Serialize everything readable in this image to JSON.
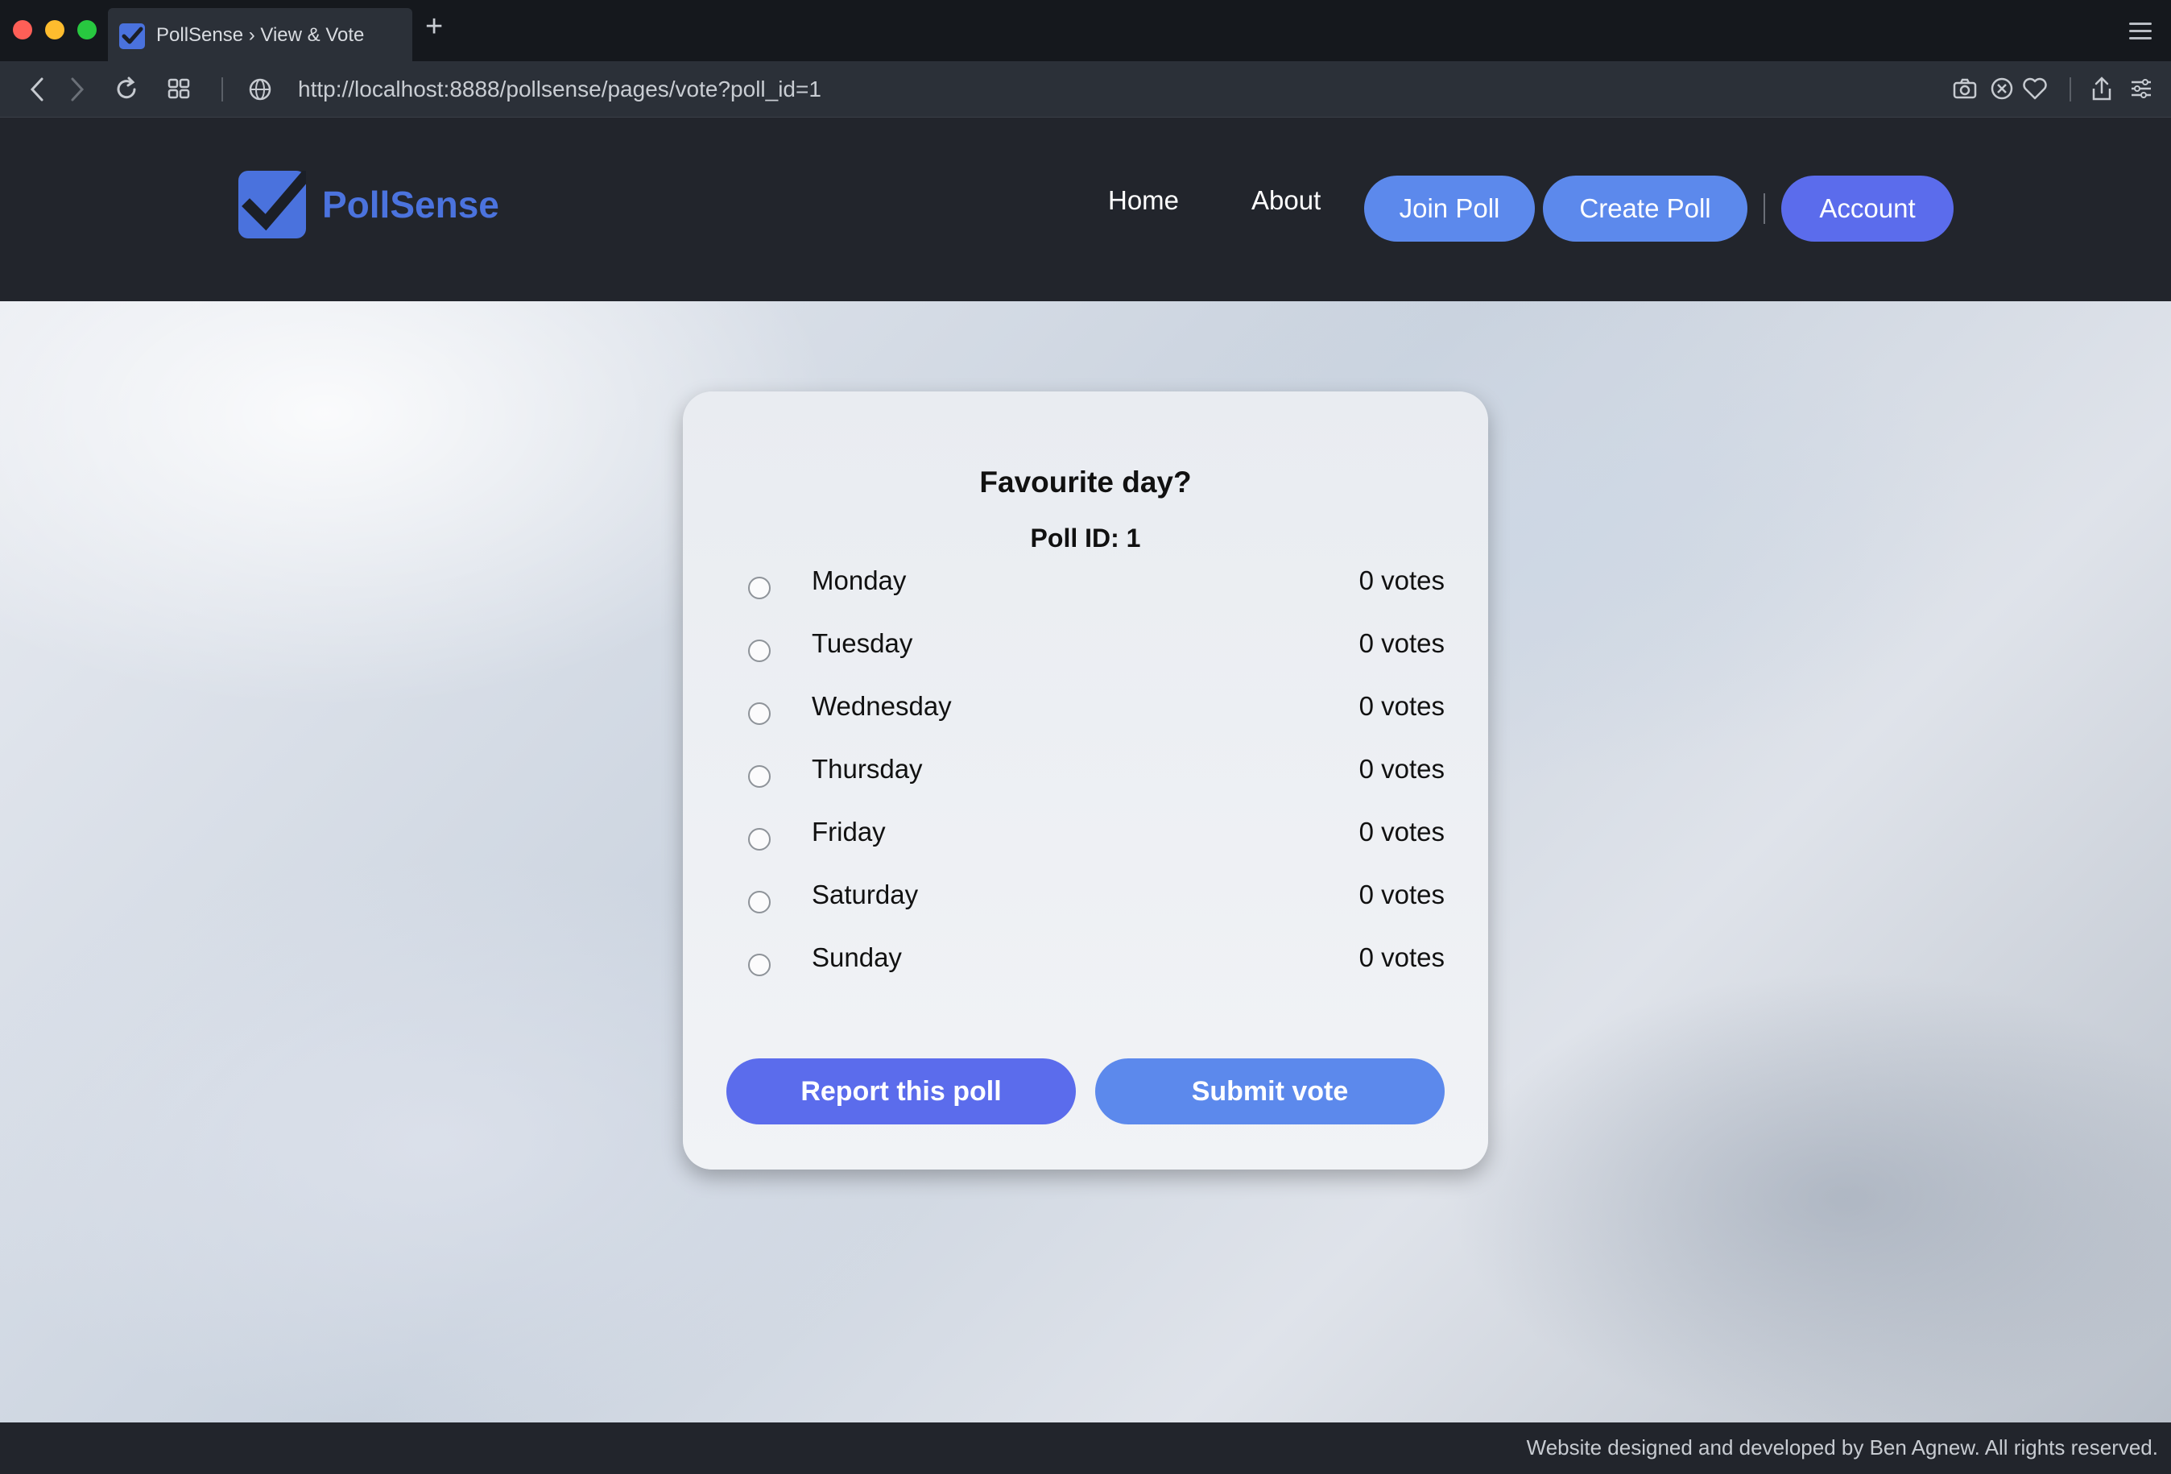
{
  "browser": {
    "tab_title": "PollSense › View & Vote",
    "url": "http://localhost:8888/pollsense/pages/vote?poll_id=1"
  },
  "header": {
    "logo_text": "PollSense",
    "nav": {
      "home": "Home",
      "about": "About",
      "join_poll": "Join Poll",
      "create_poll": "Create Poll",
      "account": "Account"
    }
  },
  "poll": {
    "title": "Favourite day?",
    "id_label": "Poll ID: 1",
    "options": [
      {
        "label": "Monday",
        "votes": "0 votes"
      },
      {
        "label": "Tuesday",
        "votes": "0 votes"
      },
      {
        "label": "Wednesday",
        "votes": "0 votes"
      },
      {
        "label": "Thursday",
        "votes": "0 votes"
      },
      {
        "label": "Friday",
        "votes": "0 votes"
      },
      {
        "label": "Saturday",
        "votes": "0 votes"
      },
      {
        "label": "Sunday",
        "votes": "0 votes"
      }
    ],
    "report_label": "Report this poll",
    "submit_label": "Submit vote"
  },
  "footer": {
    "text": "Website designed and developed by Ben Agnew. All rights reserved."
  },
  "colors": {
    "brand_blue": "#4b73de",
    "button_blue": "#5c89ec",
    "button_purple": "#5b6cec",
    "header_bg": "#22252c"
  }
}
